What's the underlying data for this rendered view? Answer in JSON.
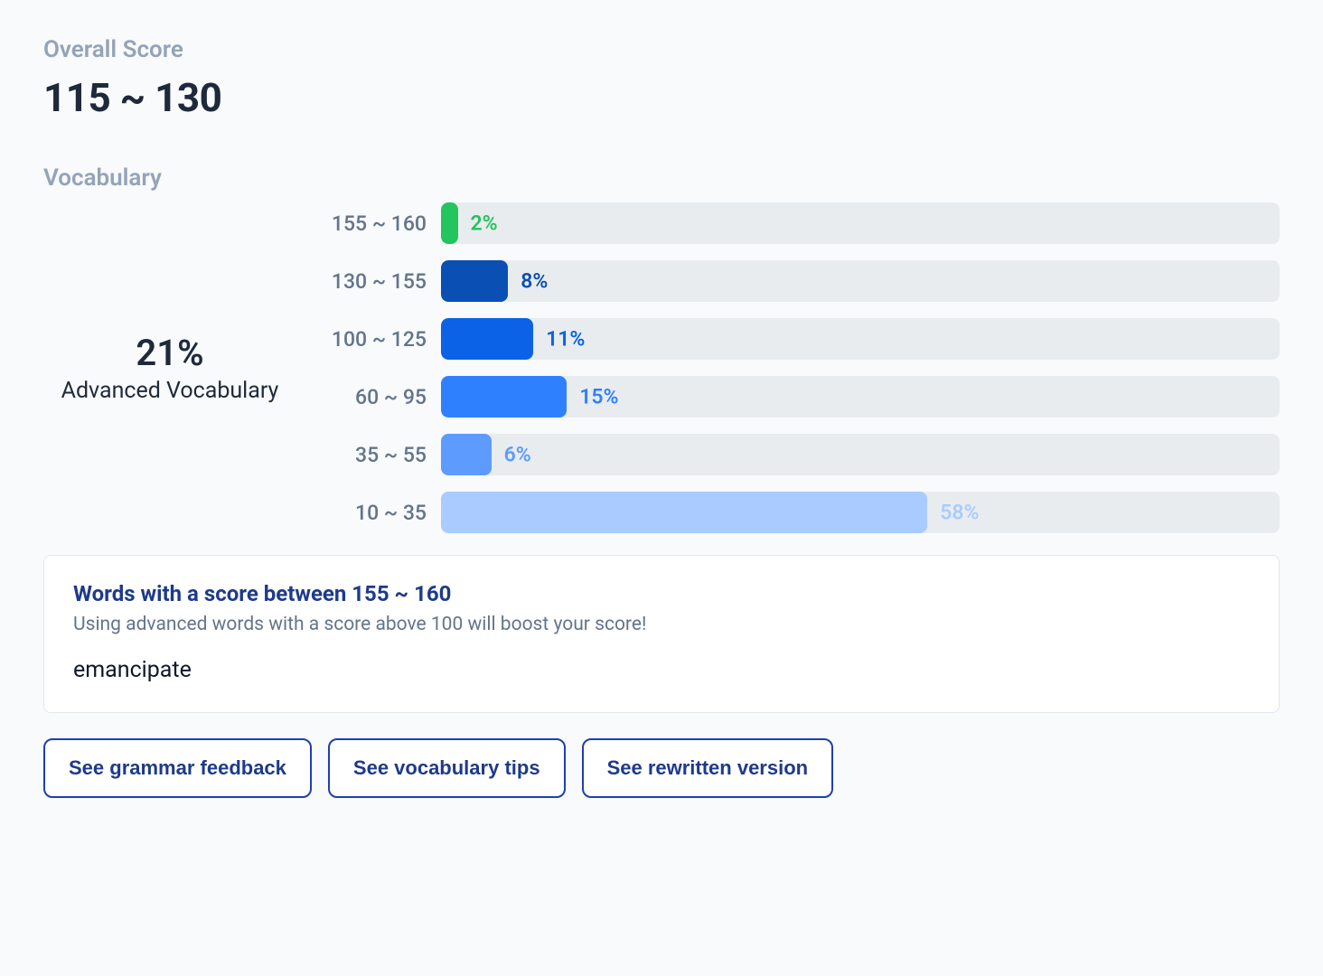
{
  "overall": {
    "label": "Overall Score",
    "value": "115 ~ 130"
  },
  "vocabulary": {
    "label": "Vocabulary",
    "advanced_pct": "21%",
    "advanced_label": "Advanced Vocabulary"
  },
  "chart_data": {
    "type": "bar",
    "title": "Vocabulary",
    "orientation": "horizontal",
    "xlabel": "",
    "ylabel": "",
    "xlim": [
      0,
      100
    ],
    "categories": [
      "155 ~ 160",
      "130 ~ 155",
      "100 ~ 125",
      "60 ~ 95",
      "35 ~ 55",
      "10 ~ 35"
    ],
    "values": [
      2,
      8,
      11,
      15,
      6,
      58
    ],
    "colors": [
      "#22c55e",
      "#0a4fb3",
      "#0b62e6",
      "#2f80ff",
      "#5d9bff",
      "#a9cbff"
    ],
    "value_labels": [
      "2%",
      "8%",
      "11%",
      "15%",
      "6%",
      "58%"
    ]
  },
  "words_card": {
    "title": "Words with a score between 155 ~ 160",
    "subtitle": "Using advanced words with a score above 100 will boost your score!",
    "words": [
      "emancipate"
    ]
  },
  "buttons": {
    "grammar": "See grammar feedback",
    "vocab": "See vocabulary tips",
    "rewrite": "See rewritten version"
  }
}
